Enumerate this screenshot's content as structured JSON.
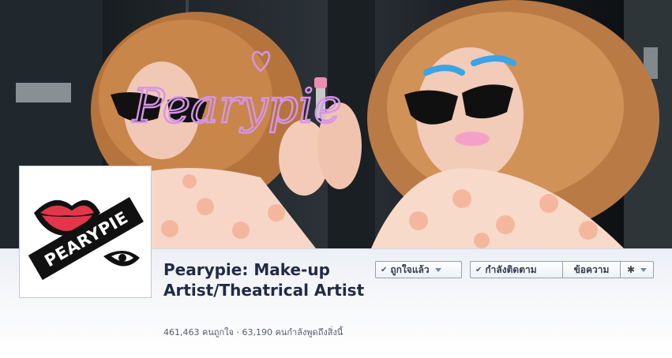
{
  "cover": {
    "scribble_text": "Pearypie",
    "heart_icon": "heart-icon"
  },
  "profile": {
    "logo_text": "PEARYPIE"
  },
  "page": {
    "title": "Pearypie: Make-up Artist/Theatrical Artist",
    "stats": "461,463 คนถูกใจ · 63,190 คนกำลังพูดถึงสิ่งนี้"
  },
  "buttons": {
    "like": "ถูกใจแล้ว",
    "following": "กำลังติดตาม",
    "message": "ข้อความ",
    "settings_icon": "gear-icon"
  }
}
